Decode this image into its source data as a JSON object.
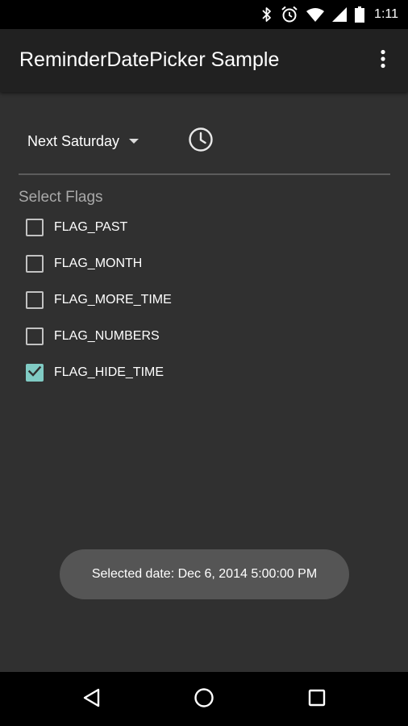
{
  "status_bar": {
    "time": "1:11",
    "icons": [
      "bluetooth-icon",
      "alarm-icon",
      "wifi-icon",
      "signal-icon",
      "battery-icon"
    ]
  },
  "app_bar": {
    "title": "ReminderDatePicker Sample",
    "overflow_icon": "overflow-menu-icon"
  },
  "picker": {
    "date_selected": "Next Saturday",
    "time_icon": "clock-icon"
  },
  "flags": {
    "section_label": "Select Flags",
    "items": [
      {
        "label": "FLAG_PAST",
        "checked": false
      },
      {
        "label": "FLAG_MONTH",
        "checked": false
      },
      {
        "label": "FLAG_MORE_TIME",
        "checked": false
      },
      {
        "label": "FLAG_NUMBERS",
        "checked": false
      },
      {
        "label": "FLAG_HIDE_TIME",
        "checked": true
      }
    ]
  },
  "toast": {
    "message": "Selected date: Dec 6, 2014 5:00:00 PM"
  },
  "nav_bar": {
    "icons": [
      "back-icon",
      "home-icon",
      "recents-icon"
    ]
  },
  "colors": {
    "background": "#303030",
    "app_bar": "#212121",
    "accent": "#80cbc4",
    "toast": "#555555"
  }
}
